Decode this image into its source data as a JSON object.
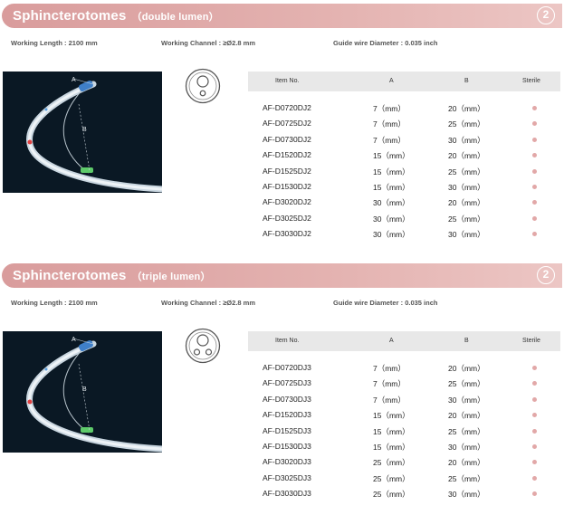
{
  "sections": [
    {
      "title": "Sphincterotomes",
      "subtitle": "（double lumen）",
      "badge": "2",
      "working_length": "Working Length : 2100 mm",
      "working_channel": "Working Channel : ≥Ø2.8 mm",
      "guide_wire": "Guide wire Diameter : 0.035 inch",
      "image_labels": {
        "a": "A",
        "b": "B"
      },
      "headers": {
        "item": "Item No.",
        "a": "A",
        "b": "B",
        "sterile": "Sterile"
      },
      "rows": [
        {
          "item": "AF-D0720DJ2",
          "a": "7（mm）",
          "b": "20（mm）"
        },
        {
          "item": "AF-D0725DJ2",
          "a": "7（mm）",
          "b": "25（mm）"
        },
        {
          "item": "AF-D0730DJ2",
          "a": "7（mm）",
          "b": "30（mm）"
        },
        {
          "item": "AF-D1520DJ2",
          "a": "15（mm）",
          "b": "20（mm）"
        },
        {
          "item": "AF-D1525DJ2",
          "a": "15（mm）",
          "b": "25（mm）"
        },
        {
          "item": "AF-D1530DJ2",
          "a": "15（mm）",
          "b": "30（mm）"
        },
        {
          "item": "AF-D3020DJ2",
          "a": "30（mm）",
          "b": "20（mm）"
        },
        {
          "item": "AF-D3025DJ2",
          "a": "30（mm）",
          "b": "25（mm）"
        },
        {
          "item": "AF-D3030DJ2",
          "a": "30（mm）",
          "b": "30（mm）"
        }
      ]
    },
    {
      "title": "Sphincterotomes",
      "subtitle": "（triple lumen）",
      "badge": "2",
      "working_length": "Working Length : 2100 mm",
      "working_channel": "Working Channel : ≥Ø2.8 mm",
      "guide_wire": "Guide wire Diameter : 0.035 inch",
      "image_labels": {
        "a": "A",
        "b": "B"
      },
      "headers": {
        "item": "Item No.",
        "a": "A",
        "b": "B",
        "sterile": "Sterile"
      },
      "rows": [
        {
          "item": "AF-D0720DJ3",
          "a": "7（mm）",
          "b": "20（mm）"
        },
        {
          "item": "AF-D0725DJ3",
          "a": "7（mm）",
          "b": "25（mm）"
        },
        {
          "item": "AF-D0730DJ3",
          "a": "7（mm）",
          "b": "30（mm）"
        },
        {
          "item": "AF-D1520DJ3",
          "a": "15（mm）",
          "b": "20（mm）"
        },
        {
          "item": "AF-D1525DJ3",
          "a": "15（mm）",
          "b": "25（mm）"
        },
        {
          "item": "AF-D1530DJ3",
          "a": "15（mm）",
          "b": "30（mm）"
        },
        {
          "item": "AF-D3020DJ3",
          "a": "25（mm）",
          "b": "20（mm）"
        },
        {
          "item": "AF-D3025DJ3",
          "a": "25（mm）",
          "b": "25（mm）"
        },
        {
          "item": "AF-D3030DJ3",
          "a": "25（mm）",
          "b": "30（mm）"
        }
      ]
    }
  ],
  "colors": {
    "banner": "#d99c9c",
    "sterile_dot": "#e2a8a8",
    "header_bg": "#e8e8e8",
    "photo_bg": "#0a1824"
  }
}
